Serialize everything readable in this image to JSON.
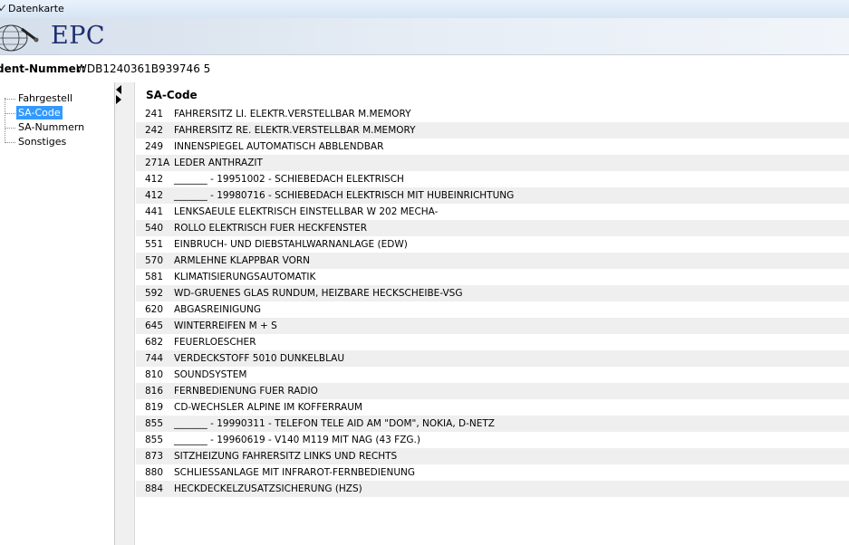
{
  "window": {
    "title": "Datenkarte"
  },
  "banner": {
    "logo_text": "EPC"
  },
  "ident": {
    "label": "dent-Nummer:",
    "value": "WDB1240361B939746 5"
  },
  "tree": {
    "items": [
      {
        "label": "Fahrgestell",
        "selected": false
      },
      {
        "label": "SA-Code",
        "selected": true
      },
      {
        "label": "SA-Nummern",
        "selected": false
      },
      {
        "label": "Sonstiges",
        "selected": false
      }
    ]
  },
  "table": {
    "header": "SA-Code",
    "rows": [
      {
        "code": "241",
        "desc": "FAHRERSITZ LI. ELEKTR.VERSTELLBAR M.MEMORY"
      },
      {
        "code": "242",
        "desc": "FAHRERSITZ RE. ELEKTR.VERSTELLBAR M.MEMORY"
      },
      {
        "code": "249",
        "desc": "INNENSPIEGEL AUTOMATISCH ABBLENDBAR"
      },
      {
        "code": "271A",
        "desc": "LEDER ANTHRAZIT"
      },
      {
        "code": "412",
        "desc": "_______ - 19951002 - SCHIEBEDACH ELEKTRISCH"
      },
      {
        "code": "412",
        "desc": "_______ - 19980716 - SCHIEBEDACH ELEKTRISCH MIT HUBEINRICHTUNG"
      },
      {
        "code": "441",
        "desc": "LENKSAEULE ELEKTRISCH EINSTELLBAR  W 202 MECHA-"
      },
      {
        "code": "540",
        "desc": "ROLLO ELEKTRISCH FUER HECKFENSTER"
      },
      {
        "code": "551",
        "desc": "EINBRUCH- UND DIEBSTAHLWARNANLAGE (EDW)"
      },
      {
        "code": "570",
        "desc": "ARMLEHNE KLAPPBAR VORN"
      },
      {
        "code": "581",
        "desc": "KLIMATISIERUNGSAUTOMATIK"
      },
      {
        "code": "592",
        "desc": "WD-GRUENES GLAS RUNDUM, HEIZBARE HECKSCHEIBE-VSG"
      },
      {
        "code": "620",
        "desc": "ABGASREINIGUNG"
      },
      {
        "code": "645",
        "desc": "WINTERREIFEN M + S"
      },
      {
        "code": "682",
        "desc": "FEUERLOESCHER"
      },
      {
        "code": "744",
        "desc": "VERDECKSTOFF 5010 DUNKELBLAU"
      },
      {
        "code": "810",
        "desc": "SOUNDSYSTEM"
      },
      {
        "code": "816",
        "desc": "FERNBEDIENUNG FUER RADIO"
      },
      {
        "code": "819",
        "desc": "CD-WECHSLER ALPINE IM KOFFERRAUM"
      },
      {
        "code": "855",
        "desc": "_______ - 19990311 - TELEFON TELE AID AM \"DOM\", NOKIA, D-NETZ"
      },
      {
        "code": "855",
        "desc": "_______ - 19960619 - V140 M119 MIT NAG (43 FZG.)"
      },
      {
        "code": "873",
        "desc": "SITZHEIZUNG FAHRERSITZ LINKS UND RECHTS"
      },
      {
        "code": "880",
        "desc": "SCHLIESSANLAGE MIT INFRAROT-FERNBEDIENUNG"
      },
      {
        "code": "884",
        "desc": "HECKDECKELZUSATZSICHERUNG (HZS)"
      }
    ]
  },
  "colors": {
    "selection": "#3399ff",
    "logo": "#1f2e72",
    "row_alt": "#efefef"
  }
}
